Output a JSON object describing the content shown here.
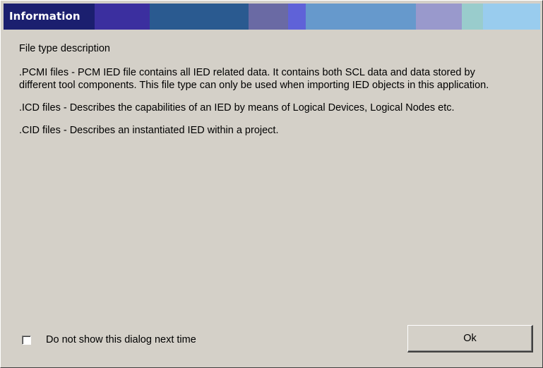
{
  "dialog": {
    "title": "Information",
    "title_colors": [
      "#1b1f6f",
      "#3b2f9f",
      "#2a5a90",
      "#6a6aa4",
      "#5f62d8",
      "#6699cc",
      "#9999cc",
      "#99cccc",
      "#99ccee"
    ]
  },
  "content": {
    "heading": "File type description",
    "paragraphs": [
      ".PCMI files  -  PCM IED file contains all IED related data. It contains both SCL data and data stored by different tool components. This file type can only be used when importing IED objects in this application.",
      ".ICD files  -  Describes the capabilities of an IED by means of Logical Devices, Logical Nodes etc.",
      ".CID files  -  Describes an instantiated IED within a project."
    ]
  },
  "footer": {
    "checkbox_label": "Do not show this dialog next time",
    "checkbox_checked": false,
    "ok_label": "Ok"
  }
}
